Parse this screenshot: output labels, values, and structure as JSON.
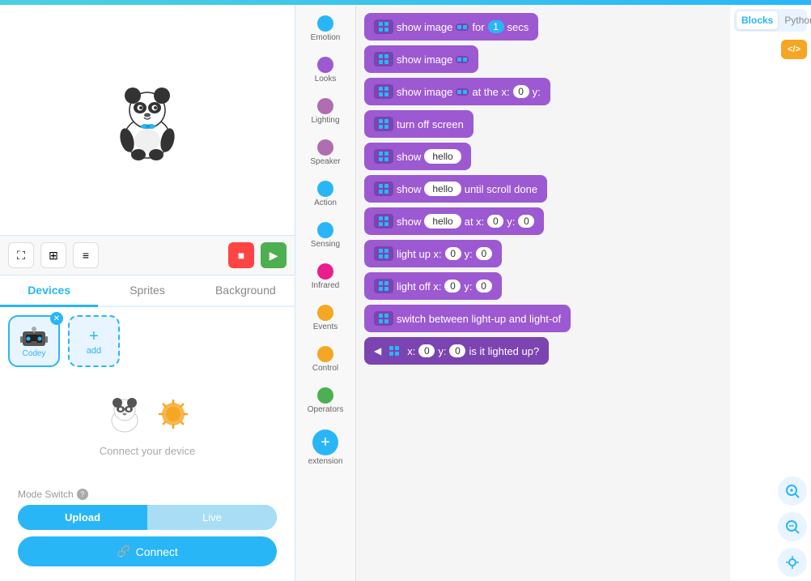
{
  "topBar": {},
  "leftPanel": {
    "tabs": [
      {
        "id": "devices",
        "label": "Devices",
        "active": true
      },
      {
        "id": "sprites",
        "label": "Sprites",
        "active": false
      },
      {
        "id": "background",
        "label": "Background",
        "active": false
      }
    ],
    "deviceCard": {
      "label": "Codey"
    },
    "addLabel": "add",
    "connectText": "Connect your device",
    "modeSwitchLabel": "Mode Switch",
    "uploadLabel": "Upload",
    "liveLabel": "Live",
    "connectBtnLabel": "Connect"
  },
  "categoryPanel": {
    "items": [
      {
        "id": "emotion",
        "label": "Emotion",
        "color": "#29b6f6"
      },
      {
        "id": "looks",
        "label": "Looks",
        "color": "#9c59d1"
      },
      {
        "id": "lighting",
        "label": "Lighting",
        "color": "#b06db0"
      },
      {
        "id": "speaker",
        "label": "Speaker",
        "color": "#b06db0"
      },
      {
        "id": "action",
        "label": "Action",
        "color": "#29b6f6"
      },
      {
        "id": "sensing",
        "label": "Sensing",
        "color": "#29b6f6"
      },
      {
        "id": "infrared",
        "label": "Infrared",
        "color": "#e91e8c"
      },
      {
        "id": "events",
        "label": "Events",
        "color": "#f5a623"
      },
      {
        "id": "control",
        "label": "Control",
        "color": "#f5a623"
      },
      {
        "id": "operators",
        "label": "Operators",
        "color": "#4caf50"
      }
    ],
    "extensionLabel": "extension"
  },
  "blocksPanel": {
    "blocks": [
      {
        "id": "b1",
        "text": "show image",
        "suffix": "for",
        "val1": "1",
        "val2": "secs"
      },
      {
        "id": "b2",
        "text": "show image"
      },
      {
        "id": "b3",
        "text": "show image at the x:",
        "xval": "0",
        "ylabel": "y:"
      },
      {
        "id": "b4",
        "text": "turn off screen"
      },
      {
        "id": "b5",
        "text": "show",
        "pill": "hello"
      },
      {
        "id": "b6",
        "text": "show",
        "pill": "hello",
        "suffix": "until scroll done"
      },
      {
        "id": "b7",
        "text": "show",
        "pill": "hello",
        "atx": "at x:",
        "xval": "0",
        "ylbl": "y:",
        "yval": "0"
      },
      {
        "id": "b8",
        "text": "light up x:",
        "xval": "0",
        "ylbl": "y:",
        "yval": "0"
      },
      {
        "id": "b9",
        "text": "light off x:",
        "xval": "0",
        "ylbl": "y:",
        "yval": "0"
      },
      {
        "id": "b10",
        "text": "switch between light-up and light-of"
      },
      {
        "id": "b11",
        "text": "x:",
        "xval": "0",
        "ylbl": "y:",
        "yval": "0",
        "suffix": "is it lighted up?"
      }
    ]
  },
  "rightPanel": {
    "langTabs": [
      {
        "id": "blocks",
        "label": "Blocks",
        "active": true
      },
      {
        "id": "python",
        "label": "Python",
        "active": false
      }
    ],
    "codeLabel": "</>",
    "tools": [
      {
        "id": "zoom-in",
        "icon": "🔍"
      },
      {
        "id": "zoom-out",
        "icon": "🔍"
      },
      {
        "id": "center",
        "icon": "⊕"
      }
    ]
  }
}
